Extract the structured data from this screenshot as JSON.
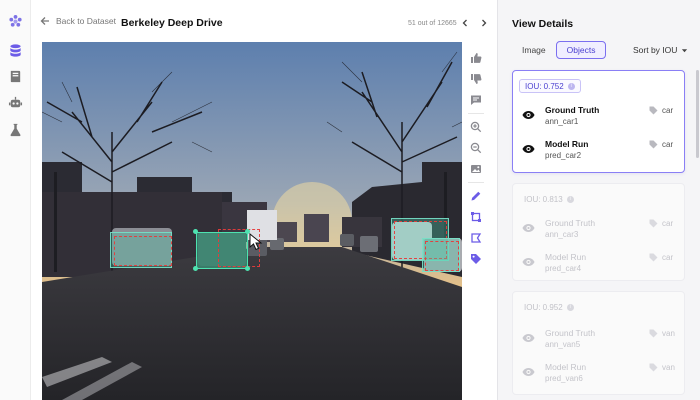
{
  "header": {
    "back_label": "Back to Dataset",
    "dataset_title": "Berkeley Deep Drive",
    "counter": "51 out of 12665"
  },
  "rail": {
    "icons": [
      "logo-icon",
      "database-icon",
      "book-icon",
      "robot-icon",
      "flask-icon"
    ],
    "accent": "#6c5ce7"
  },
  "panel": {
    "title": "View Details",
    "tabs": [
      {
        "label": "Image",
        "active": false
      },
      {
        "label": "Objects",
        "active": true
      }
    ],
    "sort_label": "Sort by IOU",
    "cards": [
      {
        "iou": "IOU: 0.752",
        "active": true,
        "rows": [
          {
            "title": "Ground Truth",
            "id": "ann_car1",
            "tag": "car"
          },
          {
            "title": "Model Run",
            "id": "pred_car2",
            "tag": "car"
          }
        ]
      },
      {
        "iou": "IOU: 0.813",
        "active": false,
        "rows": [
          {
            "title": "Ground Truth",
            "id": "ann_car3",
            "tag": "car"
          },
          {
            "title": "Model Run",
            "id": "pred_car4",
            "tag": "car"
          }
        ]
      },
      {
        "iou": "IOU: 0.952",
        "active": false,
        "rows": [
          {
            "title": "Ground Truth",
            "id": "ann_van5",
            "tag": "van"
          },
          {
            "title": "Model Run",
            "id": "pred_van6",
            "tag": "van"
          }
        ]
      }
    ]
  },
  "colors": {
    "accent": "#6c5ce7",
    "ground_truth": "#4ee3b0",
    "prediction": "#e63c3c"
  }
}
